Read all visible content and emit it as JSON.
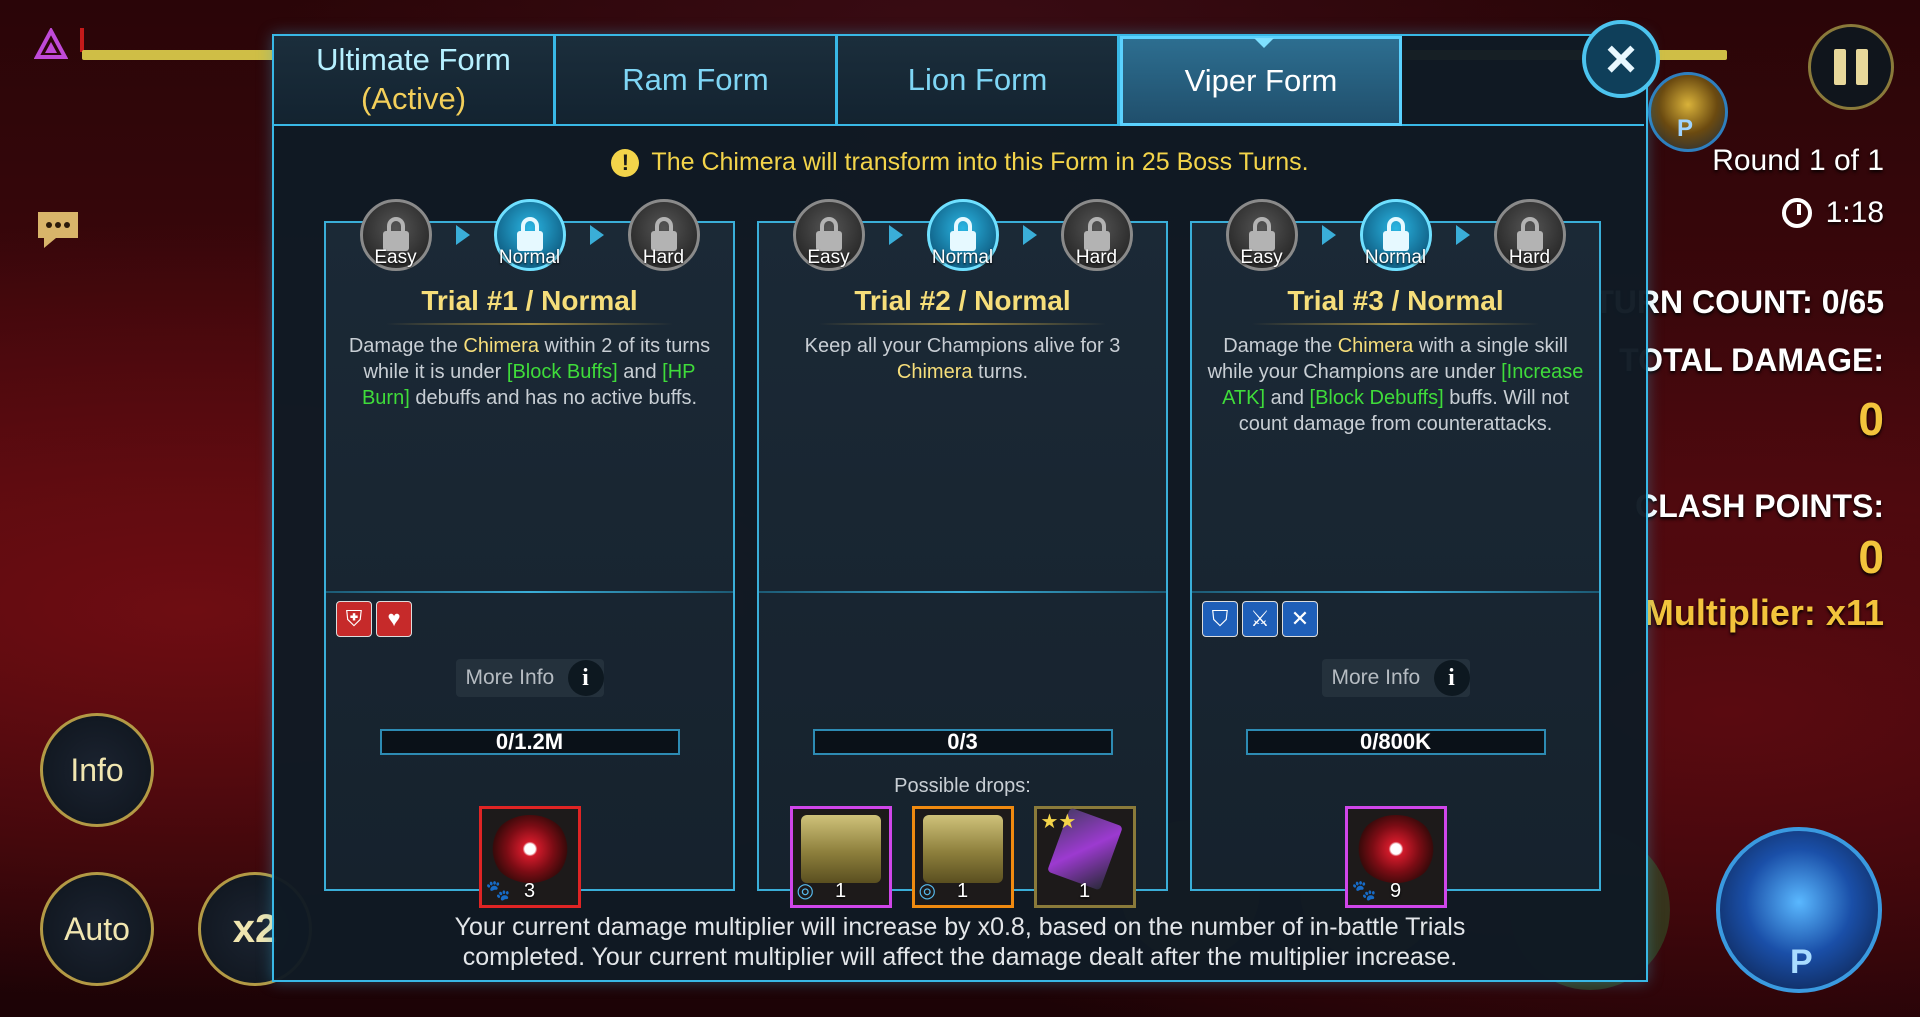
{
  "hud": {
    "round": "Round 1 of 1",
    "timer": "1:18",
    "turn_count": "TURN COUNT: 0/65",
    "total_damage_label": "TOTAL DAMAGE:",
    "total_damage_value": "0",
    "clash_points_label": "CLASH POINTS:",
    "clash_points_value": "0",
    "multiplier": "Multiplier: x11",
    "info_button": "Info",
    "auto_button": "Auto",
    "speed_button": "x2",
    "boss_badge": "P",
    "hero_badge": "P",
    "boss_hp_fraction": 1.0
  },
  "dialog": {
    "tabs": [
      {
        "label": "Ultimate Form",
        "suffix": "(Active)"
      },
      {
        "label": "Ram Form"
      },
      {
        "label": "Lion Form"
      },
      {
        "label": "Viper Form"
      }
    ],
    "selected_tab": "Viper Form",
    "close_label": "×",
    "notice": "The Chimera will transform into this Form in 25 Boss Turns.",
    "notice_icon": "!",
    "difficulties": [
      "Easy",
      "Normal",
      "Hard"
    ],
    "more_info_label": "More Info",
    "more_info_icon": "i",
    "possible_drops_label": "Possible drops:",
    "trials": [
      {
        "title": "Trial #1 / Normal",
        "desc_parts": [
          "Damage the ",
          "Chimera",
          " within 2 of its turns while it is under ",
          "[Block Buffs]",
          " and ",
          "[HP Burn]",
          " debuffs and has no active buffs."
        ],
        "effects": [
          "block-buffs-icon",
          "hp-burn-icon"
        ],
        "progress": "0/1.2M",
        "drops": [
          {
            "kind": "eye",
            "count": "3",
            "rarity": "red"
          }
        ]
      },
      {
        "title": "Trial #2 / Normal",
        "desc_parts": [
          "Keep all your Champions alive for 3 ",
          "Chimera",
          " turns."
        ],
        "effects": [],
        "progress": "0/3",
        "drops": [
          {
            "kind": "chest",
            "count": "1",
            "rarity": "purple"
          },
          {
            "kind": "chest",
            "count": "1",
            "rarity": "orange"
          },
          {
            "kind": "shard",
            "count": "1",
            "rarity": "gold"
          }
        ]
      },
      {
        "title": "Trial #3 / Normal",
        "desc_parts": [
          "Damage the ",
          "Chimera",
          " with a single skill while your Champions are under ",
          "[Increase ATK]",
          " and ",
          "[Block Debuffs]",
          " buffs. Will not count damage from counterattacks."
        ],
        "effects": [
          "shield-icon",
          "increase-atk-icon",
          "block-debuffs-icon"
        ],
        "progress": "0/800K",
        "drops": [
          {
            "kind": "eye",
            "count": "9",
            "rarity": "purple"
          }
        ]
      }
    ],
    "footer_line1": "Your current damage multiplier will increase by x0.8, based on the number of in-battle Trials",
    "footer_line2": "completed. Your current multiplier will affect the damage dealt after the multiplier increase."
  },
  "colors": {
    "accent": "#39b8e6",
    "gold": "#f3c43c",
    "highlight_green": "#3fdc3a",
    "highlight_yellow": "#f6de7a"
  }
}
